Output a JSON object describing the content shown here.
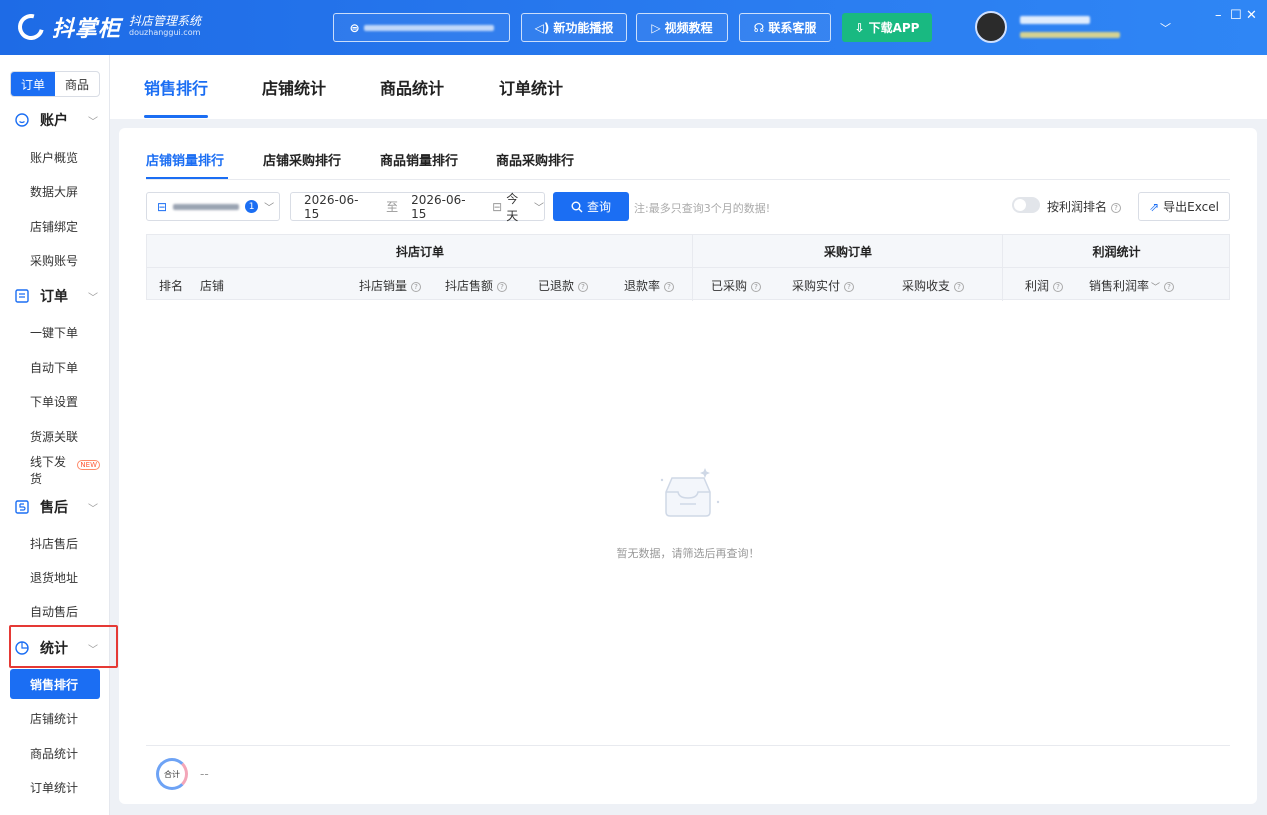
{
  "header": {
    "brand": "抖掌柜",
    "brand_sub": "抖店管理系统",
    "brand_url": "douzhanggui.com",
    "buttons": {
      "new_feature": "新功能播报",
      "video": "视频教程",
      "support": "联系客服",
      "download": "下载APP"
    },
    "controls": {
      "minimize": "–",
      "maximize": "☐",
      "close": "✕"
    }
  },
  "sidebar": {
    "seg": [
      "订单",
      "商品"
    ],
    "groups": {
      "account": {
        "label": "账户",
        "items": [
          "账户概览",
          "数据大屏",
          "店铺绑定",
          "采购账号"
        ]
      },
      "order": {
        "label": "订单",
        "items": [
          "一键下单",
          "自动下单",
          "下单设置",
          "货源关联",
          "线下发货"
        ]
      },
      "aftersale": {
        "label": "售后",
        "items": [
          "抖店售后",
          "退货地址",
          "自动售后"
        ]
      },
      "stats": {
        "label": "统计",
        "items": [
          "销售排行",
          "店铺统计",
          "商品统计",
          "订单统计"
        ]
      }
    },
    "new_tag": "NEW"
  },
  "main_tabs": [
    "销售排行",
    "店铺统计",
    "商品统计",
    "订单统计"
  ],
  "sub_tabs": [
    "店铺销量排行",
    "店铺采购排行",
    "商品销量排行",
    "商品采购排行"
  ],
  "filters": {
    "shop_count": "1",
    "date_from": "2026-06-15",
    "date_to_sep": "至",
    "date_to": "2026-06-15",
    "range": "今天",
    "query": "查询",
    "note": "注:最多只查询3个月的数据!",
    "profit_toggle": "按利润排名",
    "export": "导出Excel"
  },
  "table": {
    "groups": [
      "抖店订单",
      "采购订单",
      "利润统计"
    ],
    "columns": [
      "排名",
      "店铺",
      "抖店销量",
      "抖店售额",
      "已退款",
      "退款率",
      "已采购",
      "采购实付",
      "采购收支",
      "利润",
      "销售利润率"
    ]
  },
  "empty_text": "暂无数据，请筛选后再查询！",
  "footer": {
    "sum_label": "合计",
    "sum_value": "--"
  }
}
